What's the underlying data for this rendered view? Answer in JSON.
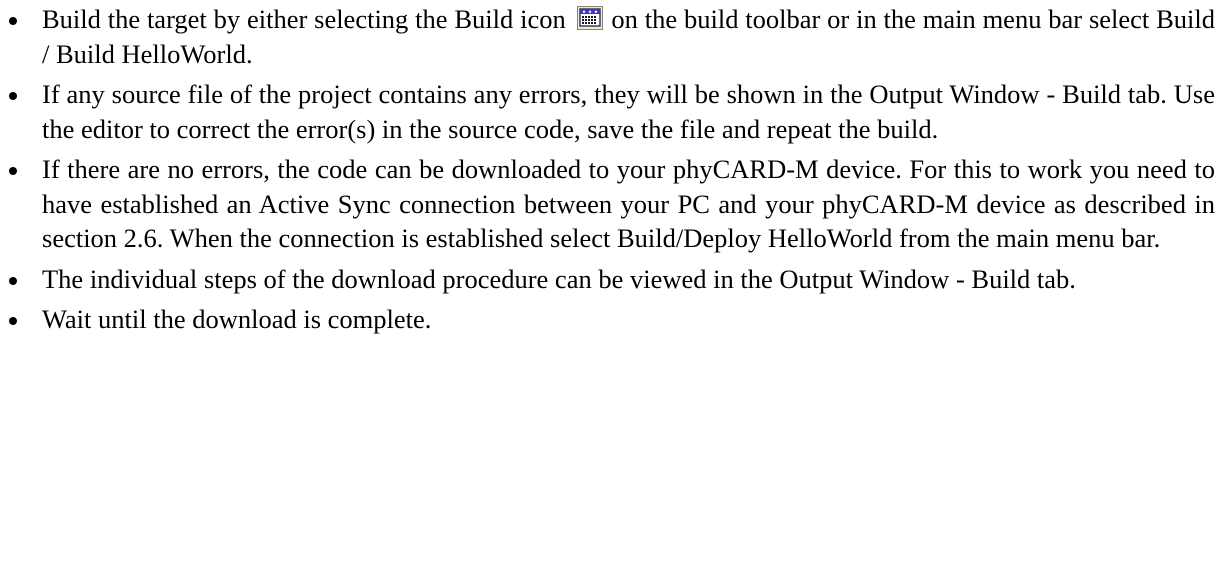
{
  "document": {
    "items": [
      {
        "before_icon": "Build the target by either selecting the Build icon",
        "icon": "build-icon",
        "after_icon": "on the build toolbar or in the main menu bar select Build / Build HelloWorld."
      },
      {
        "text": "If any source file of the project contains any errors, they will be shown in the Output Window - Build tab. Use the editor to correct the error(s) in the source code, save the file and repeat the build."
      },
      {
        "text": "If there are no errors, the code can be downloaded to your phyCARD-M device. For this to work you need to have established an Active Sync connection between your PC and your phyCARD-M device as described in section 2.6. When the connection is established select Build/Deploy HelloWorld from the main menu bar."
      },
      {
        "text": "The individual steps of the download procedure can be viewed in the Output Window - Build tab."
      },
      {
        "text": "Wait until the download is complete."
      }
    ]
  }
}
